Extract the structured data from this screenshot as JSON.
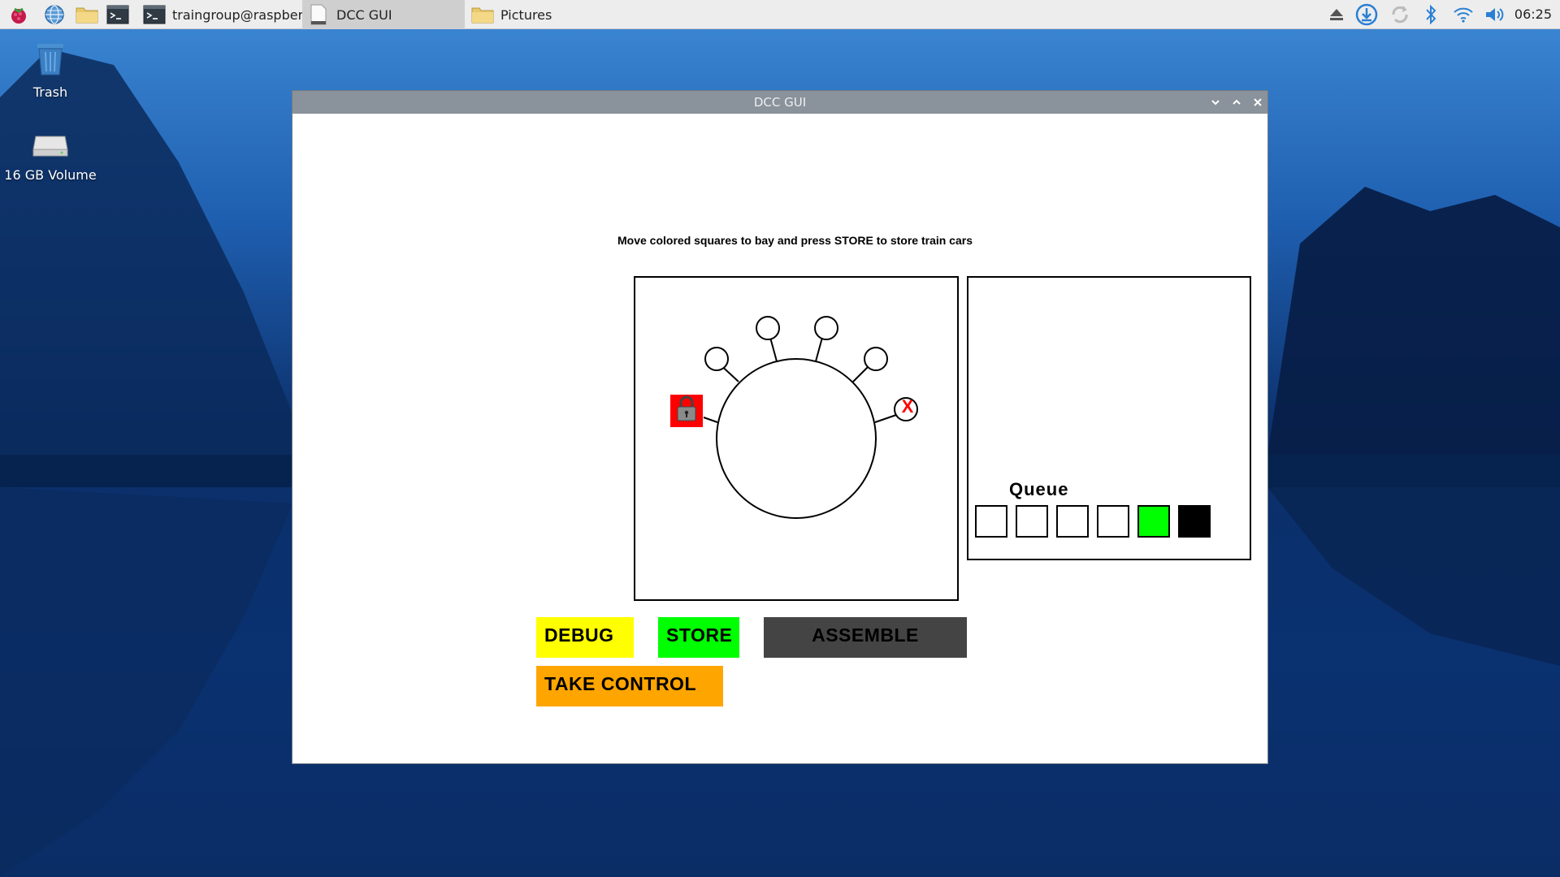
{
  "taskbar": {
    "tasks": [
      {
        "label": "traingroup@raspberr..",
        "icon": "terminal-icon"
      },
      {
        "label": "DCC GUI",
        "icon": "document-icon"
      },
      {
        "label": "Pictures",
        "icon": "folder-icon"
      }
    ],
    "clock": "06:25"
  },
  "desktop": {
    "trash_label": "Trash",
    "volume_label": "16 GB Volume"
  },
  "window": {
    "title": "DCC GUI",
    "instruction": "Move colored squares to bay and press STORE to store train cars",
    "queue": {
      "title": "Queue",
      "slots": [
        "#ffffff",
        "#ffffff",
        "#ffffff",
        "#ffffff",
        "#00ff00",
        "#000000"
      ]
    },
    "turntable": {
      "locked_bay_color": "#ff0000",
      "blocked_bay_marker": "X"
    },
    "buttons": {
      "debug": "DEBUG",
      "store": "STORE",
      "assemble": "ASSEMBLE",
      "take_control": "TAKE CONTROL"
    }
  },
  "colors": {
    "debug": "#ffff00",
    "store": "#00ff00",
    "assemble": "#444444",
    "take_control": "#ffa500",
    "titlebar": "#8a929b",
    "taskbar": "#ededed"
  }
}
